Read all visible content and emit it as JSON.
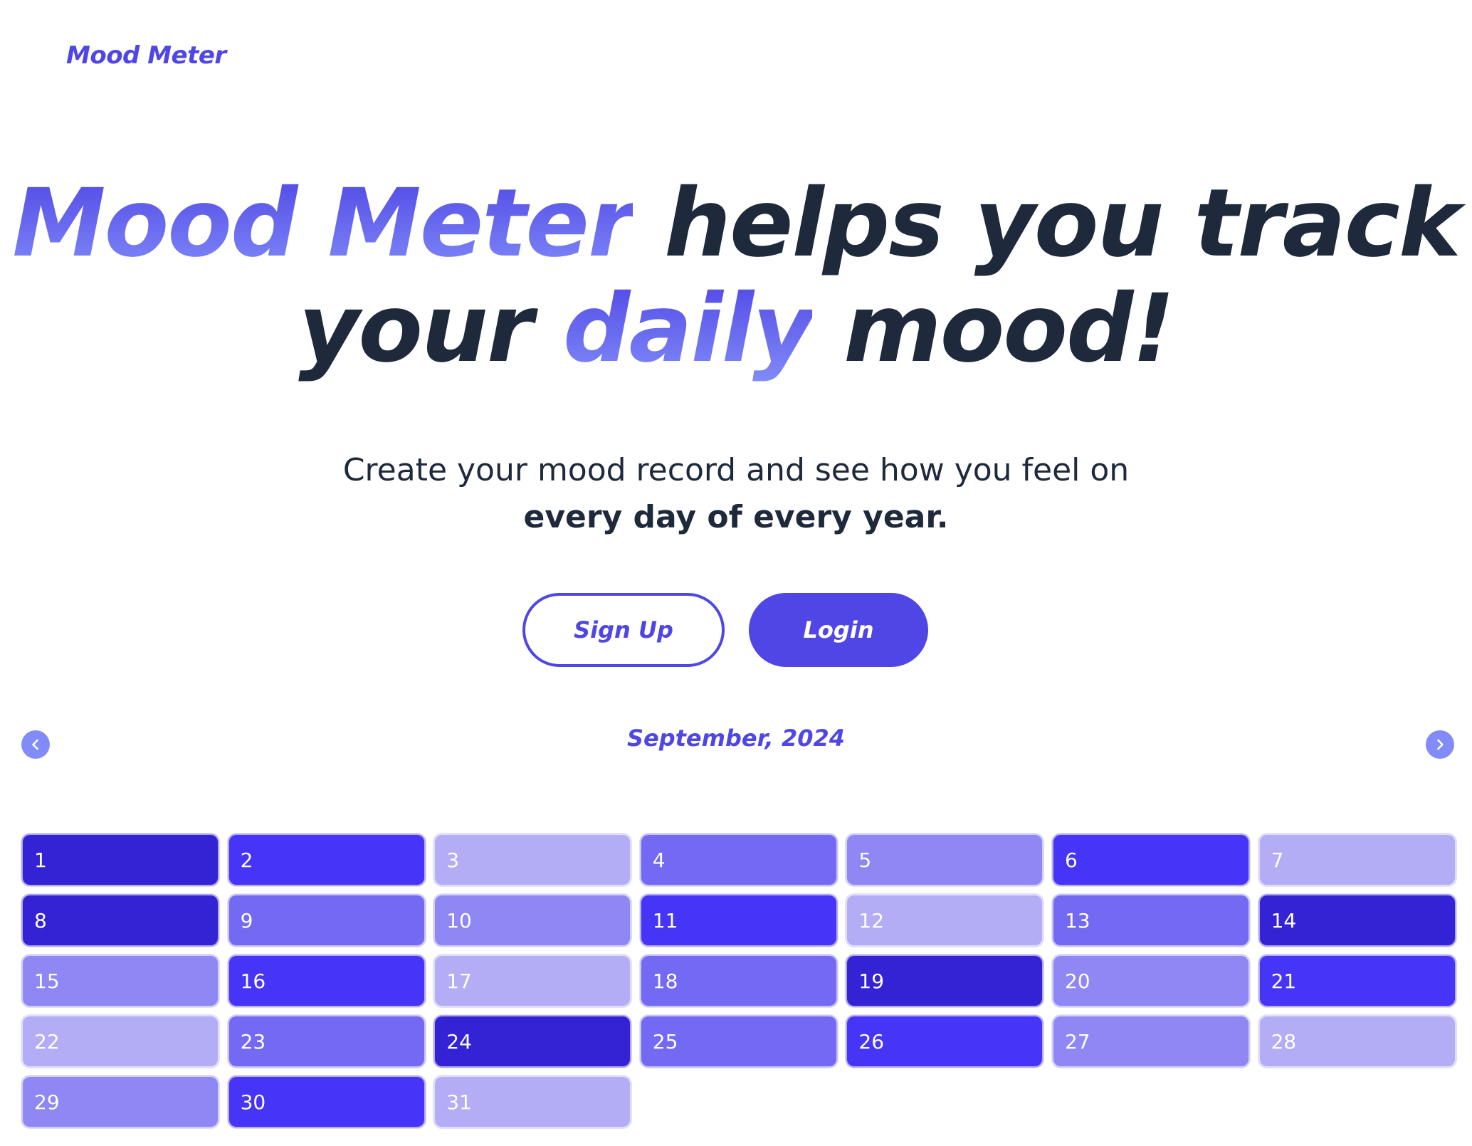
{
  "header": {
    "brand": "Mood Meter"
  },
  "hero": {
    "part1": "Mood Meter",
    "part2": " helps you track",
    "part3": "your ",
    "part4": "daily",
    "part5": " mood!"
  },
  "subtitle": {
    "line1": "Create your mood record and see how you feel on",
    "line2": "every day of every year."
  },
  "actions": {
    "signup": "Sign Up",
    "login": "Login"
  },
  "calendar": {
    "month_label": "September, 2024",
    "prev_icon": "chevron-left-icon",
    "next_icon": "chevron-right-icon",
    "colors": {
      "1": "#3423d4",
      "2": "#4634f7",
      "3": "#7469f2",
      "4": "#8f87f3",
      "5": "#b3adf6"
    },
    "days": [
      {
        "label": "1",
        "mood": 1
      },
      {
        "label": "2",
        "mood": 2
      },
      {
        "label": "3",
        "mood": 5
      },
      {
        "label": "4",
        "mood": 3
      },
      {
        "label": "5",
        "mood": 4
      },
      {
        "label": "6",
        "mood": 2
      },
      {
        "label": "7",
        "mood": 5
      },
      {
        "label": "8",
        "mood": 1
      },
      {
        "label": "9",
        "mood": 3
      },
      {
        "label": "10",
        "mood": 4
      },
      {
        "label": "11",
        "mood": 2
      },
      {
        "label": "12",
        "mood": 5
      },
      {
        "label": "13",
        "mood": 3
      },
      {
        "label": "14",
        "mood": 1
      },
      {
        "label": "15",
        "mood": 4
      },
      {
        "label": "16",
        "mood": 2
      },
      {
        "label": "17",
        "mood": 5
      },
      {
        "label": "18",
        "mood": 3
      },
      {
        "label": "19",
        "mood": 1
      },
      {
        "label": "20",
        "mood": 4
      },
      {
        "label": "21",
        "mood": 2
      },
      {
        "label": "22",
        "mood": 5
      },
      {
        "label": "23",
        "mood": 3
      },
      {
        "label": "24",
        "mood": 1
      },
      {
        "label": "25",
        "mood": 3
      },
      {
        "label": "26",
        "mood": 2
      },
      {
        "label": "27",
        "mood": 4
      },
      {
        "label": "28",
        "mood": 5
      },
      {
        "label": "29",
        "mood": 4
      },
      {
        "label": "30",
        "mood": 2
      },
      {
        "label": "31",
        "mood": 5
      }
    ]
  }
}
